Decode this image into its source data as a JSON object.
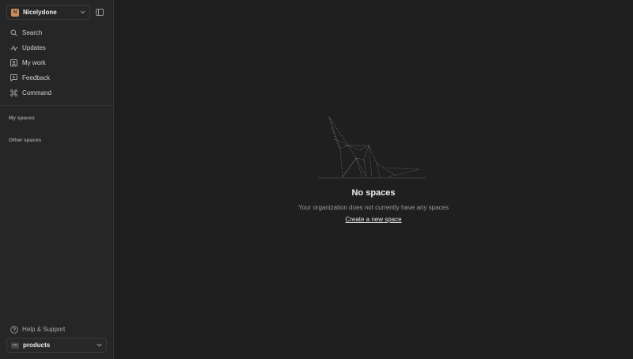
{
  "org": {
    "avatar_letter": "N",
    "name": "Nicelydone",
    "avatar_color": "#c98d5f"
  },
  "nav": [
    {
      "label": "Search",
      "icon": "search-icon"
    },
    {
      "label": "Updates",
      "icon": "activity-icon"
    },
    {
      "label": "My work",
      "icon": "inbox-icon"
    },
    {
      "label": "Feedback",
      "icon": "feedback-icon"
    },
    {
      "label": "Command",
      "icon": "command-icon"
    }
  ],
  "sections": {
    "my_spaces": "My spaces",
    "other_spaces": "Other spaces"
  },
  "help": {
    "label": "Help & Support"
  },
  "workspace": {
    "badge": "PR",
    "name": "products"
  },
  "empty_state": {
    "title": "No spaces",
    "subtitle": "Your organization does not currently have any spaces",
    "link": "Create a new space"
  }
}
